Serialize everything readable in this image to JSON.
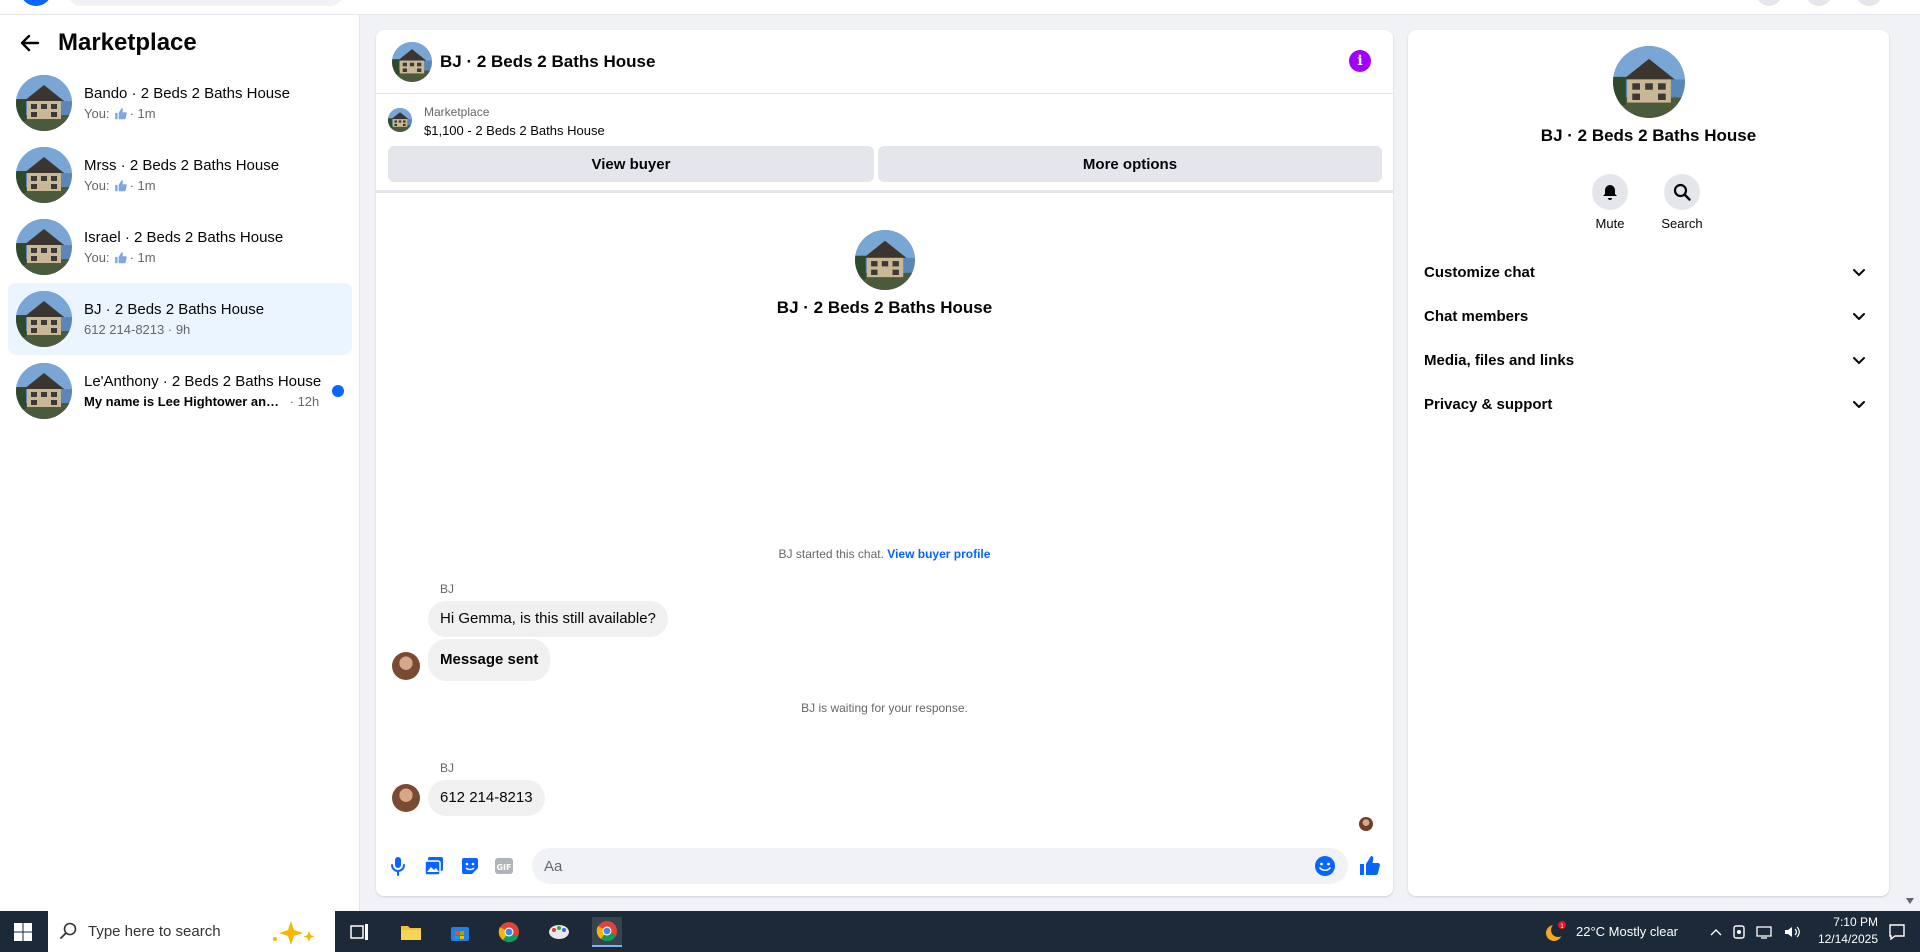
{
  "sidebar": {
    "title": "Marketplace",
    "conversations": [
      {
        "name": "Bando · 2 Beds 2 Baths House",
        "you": "You:",
        "time": "· 1m"
      },
      {
        "name": "Mrss · 2 Beds 2 Baths House",
        "you": "You:",
        "time": "· 1m"
      },
      {
        "name": "Israel · 2 Beds 2 Baths House",
        "you": "You:",
        "time": "· 1m"
      },
      {
        "name": "BJ · 2 Beds 2 Baths House",
        "preview": "612 214-8213",
        "time": "· 9h"
      },
      {
        "name": "Le'Anthony · 2 Beds 2 Baths House",
        "preview": "My name is Lee Hightower and I ...",
        "time": "· 12h"
      }
    ]
  },
  "chat": {
    "title": "BJ · 2 Beds 2 Baths House",
    "listing": {
      "label": "Marketplace",
      "price": "$1,100 - 2 Beds 2 Baths House"
    },
    "view_buyer": "View buyer",
    "more_options": "More options",
    "intro_name": "BJ · 2 Beds 2 Baths House",
    "started": "BJ started this chat.",
    "view_profile": "View buyer profile",
    "sender1": "BJ",
    "msg1": "Hi Gemma, is this still available?",
    "msg2": "Message sent",
    "waiting": "BJ is waiting for your response.",
    "sender2": "BJ",
    "msg3": "612 214-8213",
    "input_placeholder": "Aa"
  },
  "rpanel": {
    "name": "BJ · 2 Beds 2 Baths House",
    "mute": "Mute",
    "search": "Search",
    "sections": [
      "Customize chat",
      "Chat members",
      "Media, files and links",
      "Privacy & support"
    ]
  },
  "taskbar": {
    "search_placeholder": "Type here to search",
    "weather": "22°C  Mostly clear",
    "time": "7:10 PM",
    "date": "12/14/2025"
  },
  "colors": {
    "accent": "#0866ff",
    "info": "#a100ff",
    "taskbar": "#1c2938"
  }
}
